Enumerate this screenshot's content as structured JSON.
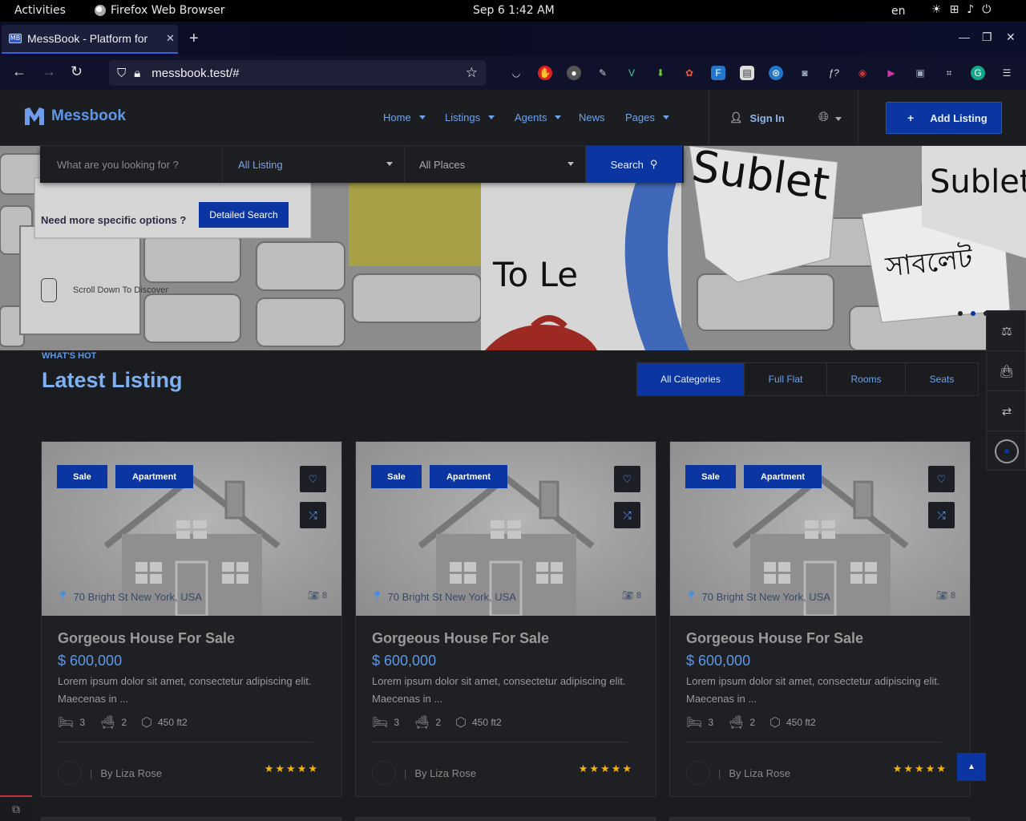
{
  "system": {
    "activities": "Activities",
    "app_name": "Firefox Web Browser",
    "clock": "Sep 6  1:42 AM",
    "lang": "en"
  },
  "browser": {
    "tab_title": "MessBook - Platform for",
    "tab_favicon": "MB",
    "url": "messbook.test/#"
  },
  "site": {
    "logo": "Messbook",
    "menu": [
      "Home",
      "Listings",
      "Agents",
      "News",
      "Pages"
    ],
    "sign_in": "Sign In",
    "add_listing": "Add Listing",
    "plus": "+",
    "accent": "#0b35a0"
  },
  "hero": {
    "search_placeholder": "What are you looking for ?",
    "listing_select": "All Listing",
    "places_select": "All Places",
    "search_button": "Search",
    "specific_text": "Need more specific options ?",
    "detailed_button": "Detailed Search",
    "scroll_text": "Scroll Down To Discover",
    "poster_sublet_1": "Sublet",
    "poster_sublet_2": "Sublet",
    "poster_tolet": "To Le",
    "poster_bangla": "সাবলেট"
  },
  "section": {
    "eyebrow": "WHAT'S HOT",
    "title": "Latest Listing",
    "categories": [
      "All Categories",
      "Full Flat",
      "Rooms",
      "Seats"
    ]
  },
  "cards": [
    {
      "badge_type": "Sale",
      "badge_kind": "Apartment",
      "address": "70 Bright St New York, USA",
      "photos": "8",
      "title": "Gorgeous House For Sale",
      "price": "$ 600,000",
      "desc": "Lorem ipsum dolor sit amet, consectetur adipiscing elit. Maecenas in ...",
      "beds": "3",
      "baths": "2",
      "area": "450 ft2",
      "agent": "By Liza Rose",
      "stars": "★★★★★"
    },
    {
      "badge_type": "Sale",
      "badge_kind": "Apartment",
      "address": "70 Bright St New York, USA",
      "photos": "8",
      "title": "Gorgeous House For Sale",
      "price": "$ 600,000",
      "desc": "Lorem ipsum dolor sit amet, consectetur adipiscing elit. Maecenas in ...",
      "beds": "3",
      "baths": "2",
      "area": "450 ft2",
      "agent": "By Liza Rose",
      "stars": "★★★★★"
    },
    {
      "badge_type": "Sale",
      "badge_kind": "Apartment",
      "address": "70 Bright St New York, USA",
      "photos": "8",
      "title": "Gorgeous House For Sale",
      "price": "$ 600,000",
      "desc": "Lorem ipsum dolor sit amet, consectetur adipiscing elit. Maecenas in ...",
      "beds": "3",
      "baths": "2",
      "area": "450 ft2",
      "agent": "By Liza Rose",
      "stars": "★★★★★"
    }
  ]
}
